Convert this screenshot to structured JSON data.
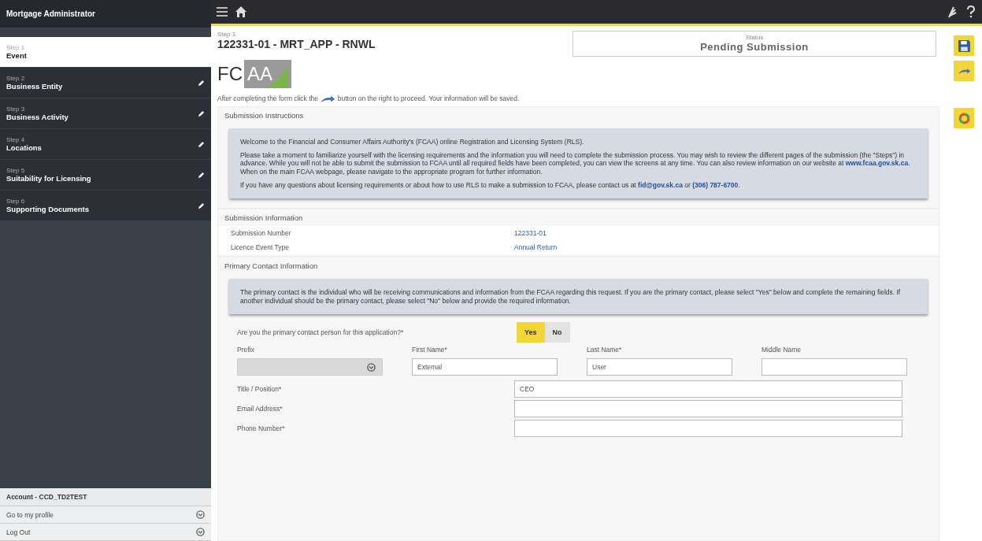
{
  "sidebar": {
    "title": "Mortgage Administrator",
    "steps": [
      {
        "step": "Step 1",
        "label": "Event",
        "selected": true,
        "edit": false
      },
      {
        "step": "Step 2",
        "label": "Business Entity",
        "selected": false,
        "edit": true
      },
      {
        "step": "Step 3",
        "label": "Business Activity",
        "selected": false,
        "edit": true
      },
      {
        "step": "Step 4",
        "label": "Locations",
        "selected": false,
        "edit": true
      },
      {
        "step": "Step 5",
        "label": "Suitability for Licensing",
        "selected": false,
        "edit": true
      },
      {
        "step": "Step 6",
        "label": "Supporting Documents",
        "selected": false,
        "edit": true
      }
    ],
    "account": "Account - CCD_TD2TEST",
    "links": [
      "Go to my profile",
      "Log Out"
    ]
  },
  "header": {
    "step": "Step 1",
    "title": "122331-01 - MRT_APP - RNWL",
    "status_label": "Status",
    "status": "Pending Submission"
  },
  "logo": {
    "dark": "FC",
    "light": "AA"
  },
  "intro": {
    "before": "After completing the form click the",
    "after": "button on the right to proceed. Your information will be saved."
  },
  "tools": [
    {
      "kind": "save"
    },
    {
      "kind": "next"
    },
    {
      "kind": "validate"
    }
  ],
  "instructions": {
    "title": "Submission Instructions",
    "paragraphs": [
      [
        {
          "kind": "text",
          "text": "Welcome to the Financial and Consumer Affairs Authority's (FCAA) online Registration and Licensing System (RLS)."
        }
      ],
      [
        {
          "kind": "text",
          "text": "Please take a moment to familiarize yourself with the licensing requirements and the information you will need to complete the submission process. You may wish to review the different pages of the submission (the \"Steps\") in advance. While you will not be able to submit the submission to FCAA until all required fields have been completed, you can view the screens at any time. You can also review information on our website at "
        },
        {
          "kind": "link",
          "text": "www.fcaa.gov.sk.ca"
        },
        {
          "kind": "text",
          "text": ". When on the main FCAA webpage, please navigate to the appropriate program for further information."
        }
      ],
      [
        {
          "kind": "text",
          "text": "If you have any questions about licensing requirements or about how to use RLS to make a submission to FCAA, please contact us at "
        },
        {
          "kind": "link",
          "text": "fid@gov.sk.ca"
        },
        {
          "kind": "text",
          "text": " or "
        },
        {
          "kind": "link",
          "text": "(306) 787-6700"
        },
        {
          "kind": "text",
          "text": "."
        }
      ]
    ]
  },
  "submission": {
    "title": "Submission Information",
    "rows": [
      {
        "label": "Submission Number",
        "value": "122331-01"
      },
      {
        "label": "Licence Event Type",
        "value": "Annual Return"
      }
    ]
  },
  "contact": {
    "title": "Primary Contact Information",
    "note": "The primary contact is the individual who will be receiving communications and information from the FCAA regarding this request. If you are the primary contact, please select \"Yes\" below and complete the remaining fields. If another individual should be the primary contact, please select \"No\" below and provide the required information.",
    "question": "Are you the primary contact person for this application?*",
    "options": [
      {
        "label": "Yes",
        "selected": true
      },
      {
        "label": "No",
        "selected": false
      }
    ],
    "name_fields": [
      {
        "label": "Prefix",
        "kind": "select",
        "disabled": true
      },
      {
        "label": "First Name*",
        "kind": "text",
        "value": "External",
        "disabled": false
      },
      {
        "label": "Last Name*",
        "kind": "text",
        "value": "User",
        "disabled": false
      },
      {
        "label": "Middle Name",
        "kind": "text",
        "disabled": false
      }
    ],
    "rows": [
      {
        "label": "Title / Position*",
        "value": "CEO"
      },
      {
        "label": "Email Address*"
      },
      {
        "label": "Phone Number*"
      }
    ]
  }
}
